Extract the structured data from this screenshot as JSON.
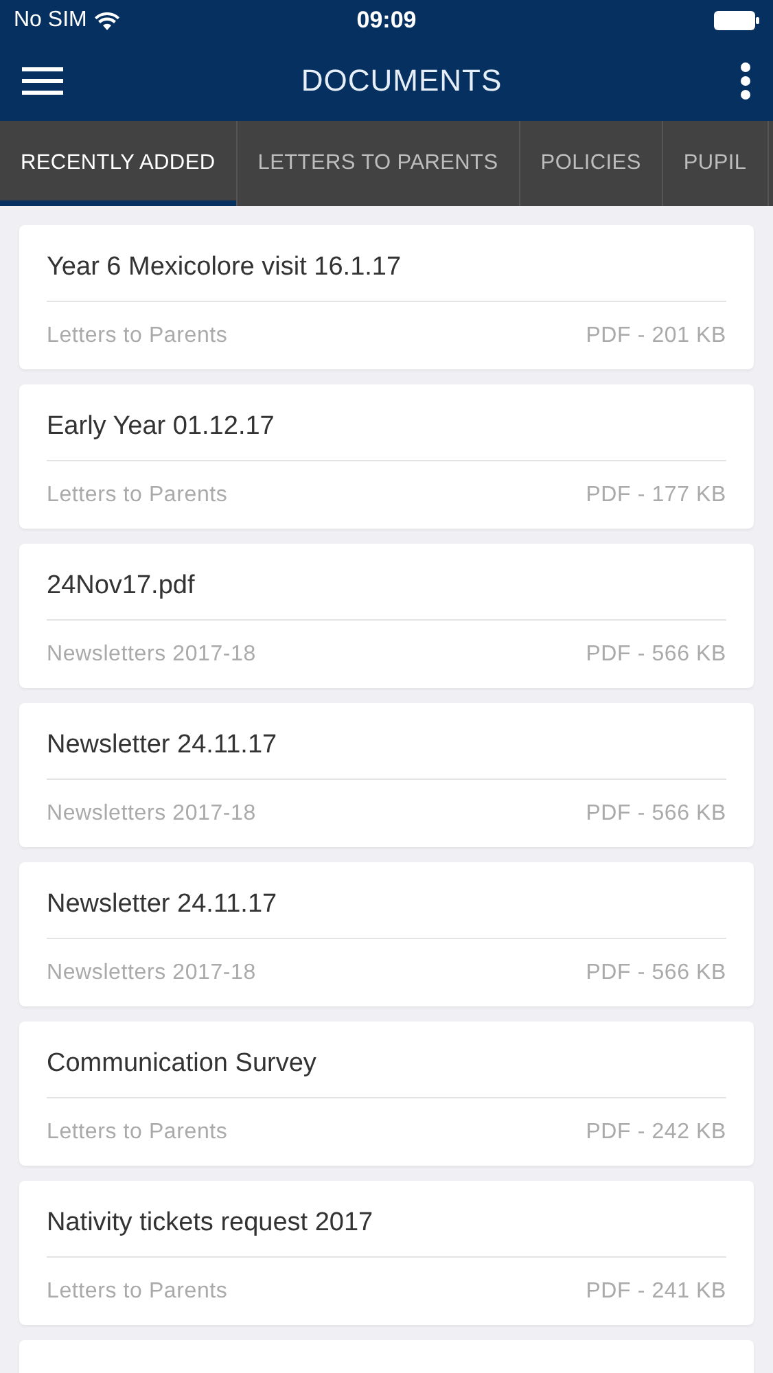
{
  "status_bar": {
    "carrier": "No SIM",
    "time": "09:09"
  },
  "header": {
    "title": "DOCUMENTS"
  },
  "tabs": [
    {
      "label": "RECENTLY ADDED",
      "selected": true
    },
    {
      "label": "LETTERS TO PARENTS",
      "selected": false
    },
    {
      "label": "POLICIES",
      "selected": false
    },
    {
      "label": "PUPIL",
      "selected": false
    }
  ],
  "documents": [
    {
      "title": "Year 6 Mexicolore visit 16.1.17",
      "category": "Letters to Parents",
      "info": "PDF - 201 KB"
    },
    {
      "title": "Early Year 01.12.17",
      "category": "Letters to Parents",
      "info": "PDF - 177 KB"
    },
    {
      "title": "24Nov17.pdf",
      "category": "Newsletters 2017-18",
      "info": "PDF - 566 KB"
    },
    {
      "title": "Newsletter 24.11.17",
      "category": "Newsletters 2017-18",
      "info": "PDF - 566 KB"
    },
    {
      "title": "Newsletter 24.11.17",
      "category": "Newsletters 2017-18",
      "info": "PDF - 566 KB"
    },
    {
      "title": "Communication Survey",
      "category": "Letters to Parents",
      "info": "PDF - 242 KB"
    },
    {
      "title": "Nativity tickets request 2017",
      "category": "Letters to Parents",
      "info": "PDF - 241 KB"
    }
  ]
}
